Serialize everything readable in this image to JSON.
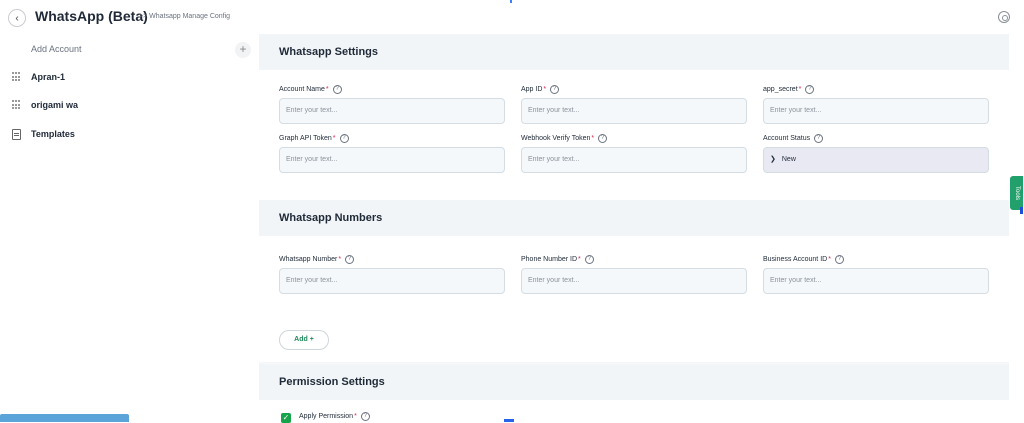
{
  "header": {
    "back_icon": "chevron-left-icon",
    "title": "WhatsApp (Beta)",
    "breadcrumb": ">> Whatsapp Manage Config",
    "settings_icon": "settings-icon"
  },
  "sidebar": {
    "add_account_label": "Add Account",
    "add_icon": "plus-icon",
    "items": [
      {
        "label": "Apran-1",
        "icon": "grid-icon"
      },
      {
        "label": "origami wa",
        "icon": "grid-icon"
      },
      {
        "label": "Templates",
        "icon": "document-icon"
      }
    ]
  },
  "whatsapp_settings": {
    "title": "Whatsapp Settings",
    "fields": [
      {
        "label": "Account Name",
        "required": "*",
        "placeholder": "Enter your text..."
      },
      {
        "label": "App ID",
        "required": "*",
        "placeholder": "Enter your text..."
      },
      {
        "label": "app_secret",
        "required": "*",
        "placeholder": "Enter your text..."
      },
      {
        "label": "Graph API Token",
        "required": "*",
        "placeholder": "Enter your text..."
      },
      {
        "label": "Webhook Verify Token",
        "required": "*",
        "placeholder": "Enter your text..."
      },
      {
        "label": "Account Status",
        "required": "",
        "value": "New"
      }
    ]
  },
  "whatsapp_numbers": {
    "title": "Whatsapp Numbers",
    "fields": [
      {
        "label": "Whatsapp Number",
        "required": "*",
        "placeholder": "Enter your text..."
      },
      {
        "label": "Phone Number ID",
        "required": "*",
        "placeholder": "Enter your text..."
      },
      {
        "label": "Business Account ID",
        "required": "*",
        "placeholder": "Enter your text..."
      }
    ],
    "add_button": "Add +"
  },
  "permission_settings": {
    "title": "Permission Settings",
    "apply_permission_label": "Apply Permission",
    "apply_permission_required": "*"
  },
  "tools_tab_label": "Tools",
  "help_glyph": "?",
  "colors": {
    "accent_green": "#16a34a",
    "required_red": "#e11d48",
    "select_bg": "#e8e9f3"
  }
}
